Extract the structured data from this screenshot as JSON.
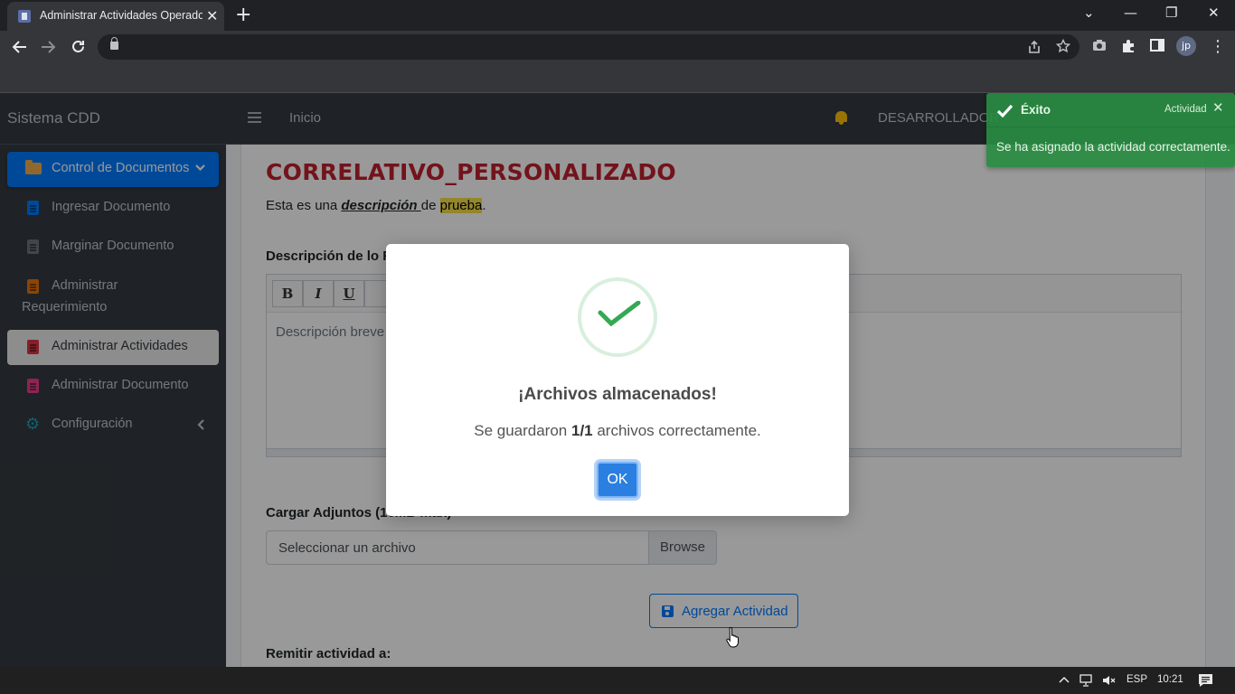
{
  "browser": {
    "tab_title": "Administrar Actividades Operado",
    "tab_close": "✕",
    "new_tab": "+",
    "window_controls": [
      "⌄",
      "—",
      "❐",
      "✕"
    ],
    "nav_icons": [
      "arrow-left-icon",
      "arrow-right-icon",
      "reload-icon"
    ],
    "omnibox_icons": [
      "share-icon",
      "star-icon"
    ],
    "extension_icons": [
      "camera-icon",
      "puzzle-icon",
      "sidepanel-icon"
    ],
    "profile_initials": "jp",
    "menu_icon": "⋮"
  },
  "sidebar": {
    "brand": "Sistema CDD",
    "items": [
      {
        "label": "Control de Documentos",
        "icon": "folder-open-icon",
        "color": "#f0ad4e"
      },
      {
        "label": "Ingresar Documento",
        "icon": "file-upload-icon",
        "color": "#007bff"
      },
      {
        "label": "Marginar Documento",
        "icon": "file-icon",
        "color": "#6c757d"
      },
      {
        "label": "Administrar",
        "label2": "Requerimiento",
        "icon": "file-icon",
        "color": "#e8730c"
      },
      {
        "label": "Administrar Actividades",
        "icon": "file-pdf-icon",
        "color": "#dc3545"
      },
      {
        "label": "Administrar Documento",
        "icon": "file-icon",
        "color": "#e83e8c"
      },
      {
        "label": "Configuración",
        "icon": "gear-icon",
        "color": "#17a2b8"
      }
    ]
  },
  "topnav": {
    "inicio": "Inicio",
    "user": "DESARROLLADOR"
  },
  "main": {
    "heading": "CORRELATIVO_PERSONALIZADO",
    "desc_prefix": "Esta es una ",
    "desc_em": "descripción ",
    "desc_mid": "de ",
    "desc_mark": "prueba",
    "desc_suffix": ".",
    "field1_label": "Descripción de lo R",
    "editor_buttons": [
      "B",
      "I",
      "U"
    ],
    "editor_placeholder": "Descripción breve",
    "attach_label": "Cargar Adjuntos (10MB max)",
    "file_placeholder": "Seleccionar un archivo",
    "browse": "Browse",
    "add_button": "Agregar Actividad",
    "remit_label": "Remitir actividad a:"
  },
  "toast": {
    "title": "Éxito",
    "subtitle": "Actividad",
    "close": "✕",
    "message": "Se ha asignado la actividad correctamente."
  },
  "modal": {
    "title": "¡Archivos almacenados!",
    "text_prefix": "Se guardaron ",
    "text_count": "1/1",
    "text_suffix": " archivos correctamente.",
    "ok": "OK"
  },
  "taskbar": {
    "lang": "ESP",
    "time": "10:21"
  },
  "colors": {
    "heading": "#c0202d",
    "primary": "#007bff",
    "success": "#28a745",
    "sidebar_bg": "#343a40"
  }
}
